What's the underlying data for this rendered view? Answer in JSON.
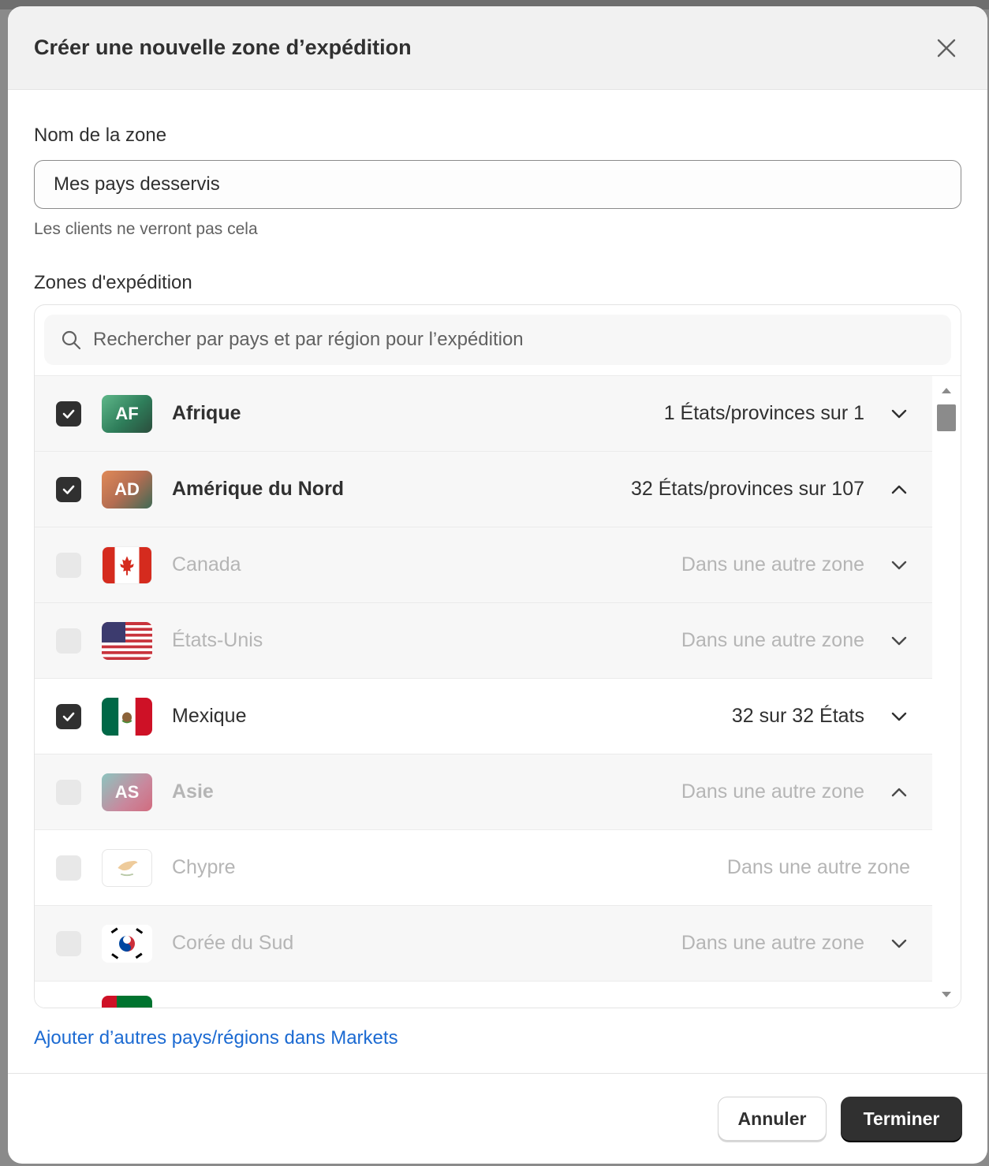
{
  "modal": {
    "title": "Créer une nouvelle zone d’expédition",
    "close_icon": "close-icon"
  },
  "zone_name": {
    "label": "Nom de la zone",
    "value": "Mes pays desservis",
    "help": "Les clients ne verront pas cela"
  },
  "zones": {
    "label": "Zones d'expédition",
    "search_placeholder": "Rechercher par pays et par région pour l’expédition",
    "rows": [
      {
        "badge": "AF",
        "name": "Afrique",
        "count": "1 États/provinces sur 1",
        "checked": true,
        "disabled": false,
        "chevron": "down"
      },
      {
        "badge": "AD",
        "name": "Amérique du Nord",
        "count": "32 États/provinces sur 107",
        "checked": true,
        "disabled": false,
        "chevron": "up"
      },
      {
        "flag": "canada-flag-icon",
        "name": "Canada",
        "count": "Dans une autre zone",
        "checked": false,
        "disabled": true,
        "chevron": "down"
      },
      {
        "flag": "usa-flag-icon",
        "name": "États-Unis",
        "count": "Dans une autre zone",
        "checked": false,
        "disabled": true,
        "chevron": "down"
      },
      {
        "flag": "mexico-flag-icon",
        "name": "Mexique",
        "count": "32 sur 32 États",
        "checked": true,
        "disabled": false,
        "chevron": "down"
      },
      {
        "badge": "AS",
        "name": "Asie",
        "count": "Dans une autre zone",
        "checked": false,
        "disabled": true,
        "chevron": "up"
      },
      {
        "flag": "cyprus-flag-icon",
        "name": "Chypre",
        "count": "Dans une autre zone",
        "checked": false,
        "disabled": true,
        "chevron": "none"
      },
      {
        "flag": "south-korea-flag-icon",
        "name": "Corée du Sud",
        "count": "Dans une autre zone",
        "checked": false,
        "disabled": true,
        "chevron": "down"
      }
    ]
  },
  "add_link": "Ajouter d’autres pays/régions dans Markets",
  "footer": {
    "cancel_label": "Annuler",
    "done_label": "Terminer"
  },
  "colors": {
    "accent_link": "#1b6ad2",
    "primary_button": "#303030"
  }
}
